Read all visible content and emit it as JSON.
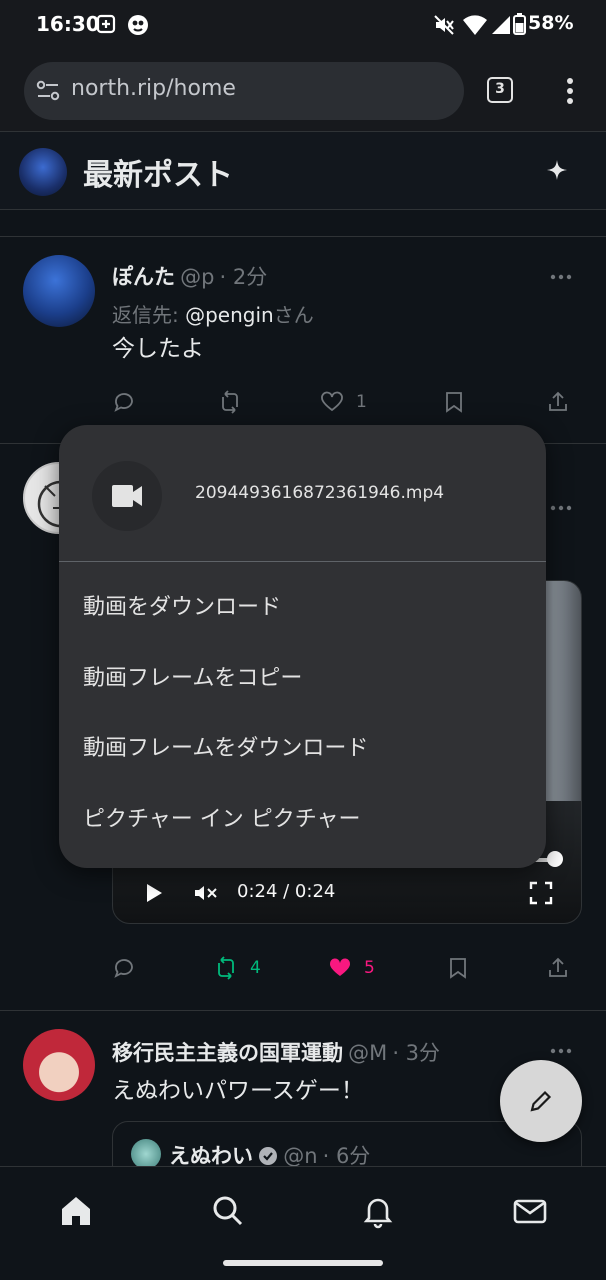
{
  "status": {
    "time": "16:30",
    "battery": "58%"
  },
  "browser": {
    "url": "north.rip/home",
    "tab_count": "3"
  },
  "header": {
    "title": "最新ポスト"
  },
  "posts": [
    {
      "name": "ぽんた",
      "handle": "@p",
      "time": "· 2分",
      "reply_label": "返信先:",
      "reply_to": "@pengin",
      "reply_suffix": "さん",
      "text": "今したよ",
      "likes": "1"
    },
    {
      "video_time": "0:24 / 0:24",
      "reposts": "4",
      "likes": "5"
    },
    {
      "name": "移行民主主義の国軍運動",
      "handle": "@M",
      "time": "· 3分",
      "text": "えぬわいパワースゲー！",
      "quote": {
        "name": "えぬわい",
        "handle": "@n",
        "time": "· 6分"
      }
    }
  ],
  "menu": {
    "filename": "2094493616872361946.mp4",
    "items": [
      "動画をダウンロード",
      "動画フレームをコピー",
      "動画フレームをダウンロード",
      "ピクチャー イン ピクチャー"
    ]
  },
  "colors": {
    "background": "#0f1419",
    "menu": "#303134",
    "like": "#f91880",
    "repost": "#00ba7c",
    "muted": "#71767b"
  },
  "icons": [
    "home-icon",
    "search-icon",
    "bell-icon",
    "mail-icon",
    "pencil-icon",
    "video-camera-icon",
    "sparkle-icon",
    "reply-icon",
    "repost-icon",
    "heart-icon",
    "bookmark-icon",
    "share-icon"
  ]
}
